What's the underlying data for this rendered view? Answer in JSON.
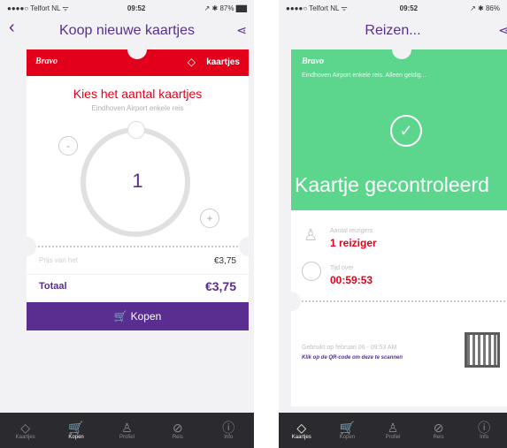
{
  "left": {
    "status": {
      "carrier": "●●●●○ Telfort NL ᯤ",
      "time": "09:52",
      "battery": "↗ ✱ 87% ▇▇"
    },
    "nav": {
      "back": "‹",
      "title": "Koop nieuwe kaartjes",
      "share": "⋖"
    },
    "brand": "Bravo",
    "tickets_label": "kaartjes",
    "heading": "Kies het aantal kaartjes",
    "subheading": "Eindhoven Airport enkele reis",
    "minus": "-",
    "plus": "+",
    "count": "1",
    "price_label": "Prijs van het",
    "price_value": "€3,75",
    "total_label": "Totaal",
    "total_value": "€3,75",
    "buy_label": "Kopen",
    "tabs": [
      {
        "icon": "◇",
        "label": "Kaartjes"
      },
      {
        "icon": "🛒",
        "label": "Kopen"
      },
      {
        "icon": "♙",
        "label": "Profiel"
      },
      {
        "icon": "⊘",
        "label": "Reis"
      },
      {
        "icon": "ⓘ",
        "label": "Info"
      }
    ]
  },
  "right": {
    "status": {
      "carrier": "●●●●○ Telfort NL ᯤ",
      "time": "09:52",
      "battery": "↗ ✱ 86%"
    },
    "nav": {
      "title": "Reizen...",
      "share": "⋖"
    },
    "brand": "Bravo",
    "description": "Eindhoven Airport enkele reis. Alleen geldig...",
    "check": "✓",
    "status_text": "Kaartje gecontroleerd",
    "travelers_label": "Aantal reizigers",
    "travelers_value": "1 reiziger",
    "time_label": "Tijd over",
    "time_value": "00:59:53",
    "used_label": "Gebruikt op februari 06 - 09:53 AM",
    "scan_hint": "Klik op de QR-code om deze te scannen",
    "tabs": [
      {
        "icon": "◇",
        "label": "Kaartjes"
      },
      {
        "icon": "🛒",
        "label": "Kopen"
      },
      {
        "icon": "♙",
        "label": "Profiel"
      },
      {
        "icon": "⊘",
        "label": "Reis"
      },
      {
        "icon": "ⓘ",
        "label": "Info"
      }
    ]
  },
  "colors": {
    "purple": "#5a2d91",
    "red": "#e3001b",
    "green": "#5dd68d"
  }
}
